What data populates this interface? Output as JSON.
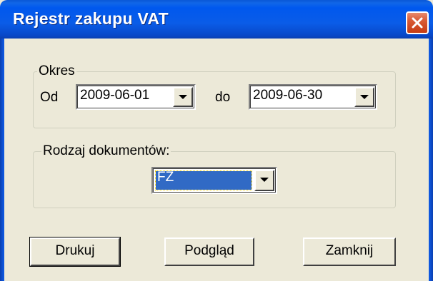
{
  "window": {
    "title": "Rejestr zakupu VAT"
  },
  "period_group": {
    "legend": "Okres",
    "from_label": "Od",
    "from_value": "2009-06-01",
    "to_label": "do",
    "to_value": "2009-06-30"
  },
  "doc_type_group": {
    "legend": "Rodzaj dokumentów:",
    "selected_value": "FZ"
  },
  "buttons": {
    "print": "Drukuj",
    "preview": "Podgląd",
    "close": "Zamknij"
  },
  "icons": {
    "title_close": "close-x-icon",
    "dropdown": "chevron-down-icon"
  },
  "colors": {
    "titlebar": "#0058ee",
    "close_button": "#d85a35",
    "dialog_background": "#ece9d8",
    "selection": "#316ac5"
  }
}
